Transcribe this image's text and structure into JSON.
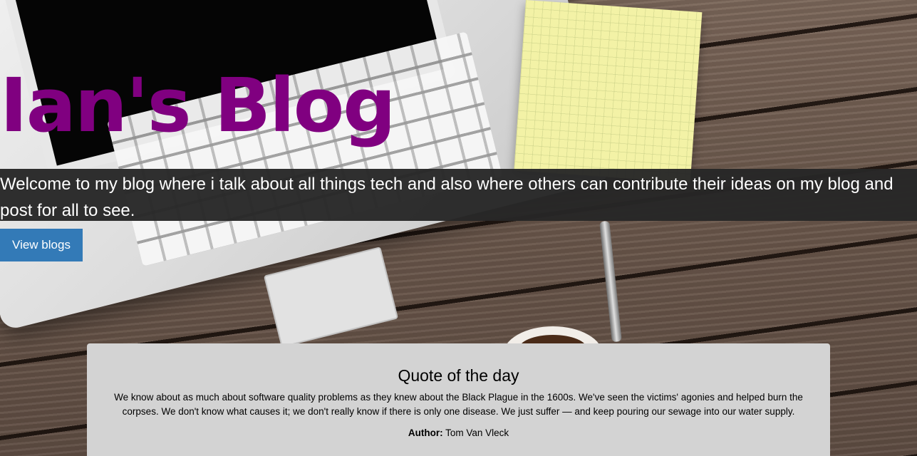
{
  "hero": {
    "title": "Ian's Blog",
    "welcome": "Welcome to my blog where i talk about all things tech and also where others can contribute their ideas on my blog and post for all to see.",
    "view_blogs_label": "View blogs"
  },
  "quote": {
    "heading": "Quote of the day",
    "text": "We know about as much about software quality problems as they knew about the Black Plague in the 1600s. We've seen the victims' agonies and helped burn the corpses. We don't know what causes it; we don't really know if there is only one disease. We just suffer — and keep pouring our sewage into our water supply.",
    "author_label": "Author:",
    "author_name": "Tom Van Vleck"
  },
  "colors": {
    "title": "#800080",
    "banner_background": "#262626",
    "button_background": "#337ab7",
    "quote_card_background": "#d3d3d3"
  }
}
